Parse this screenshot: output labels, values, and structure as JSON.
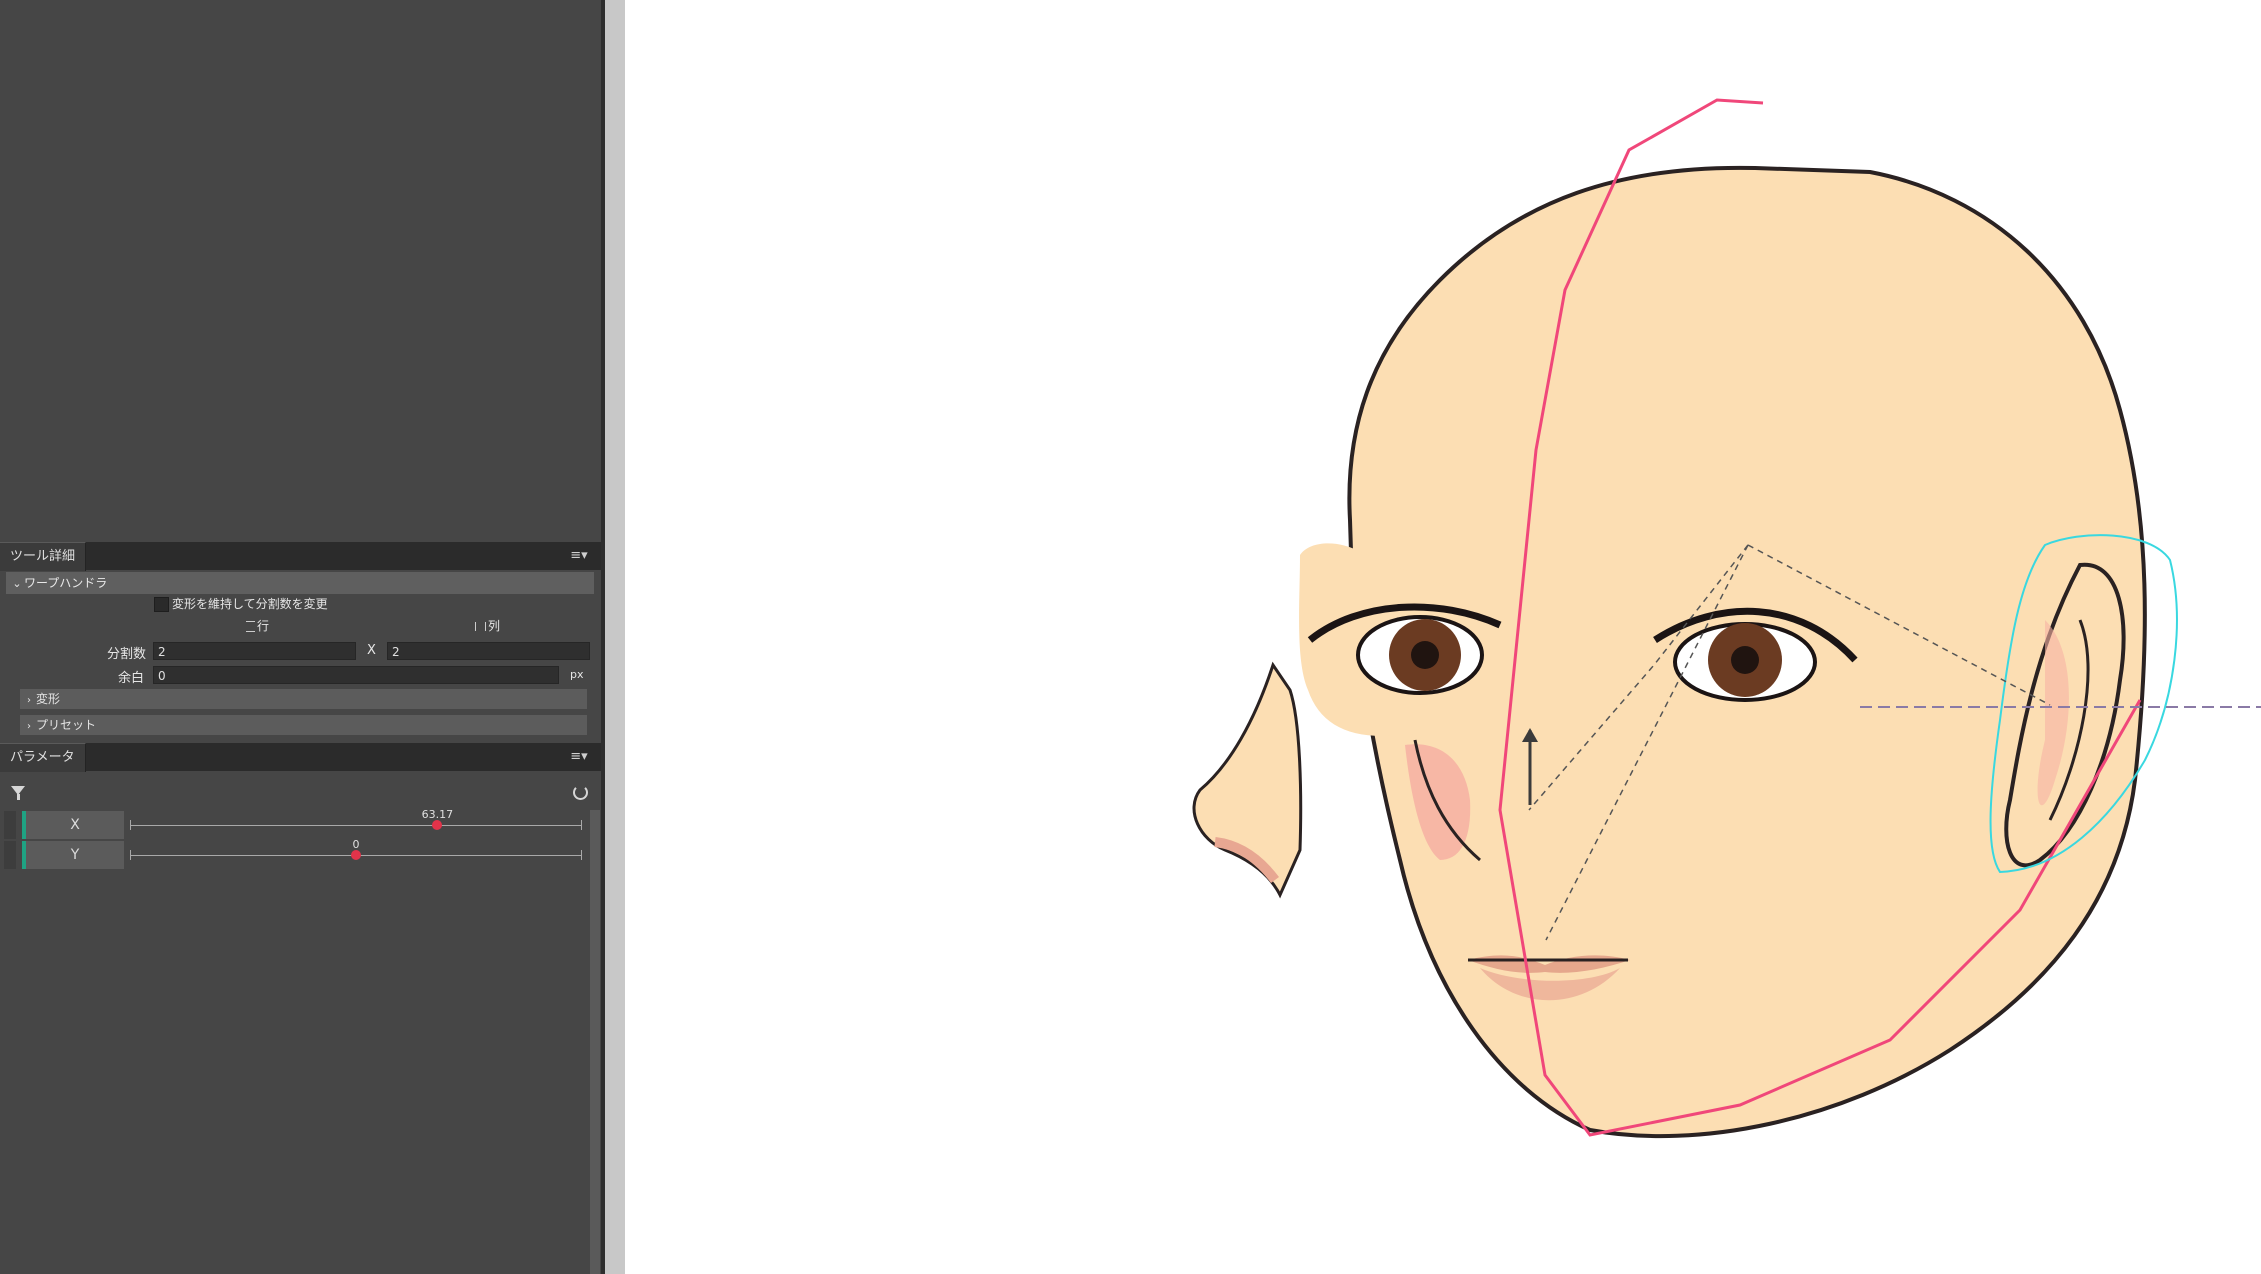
{
  "tool_detail": {
    "tab_label": "ツール詳細",
    "menu_icon": "panel-menu-icon",
    "section_label": "ワープハンドラ",
    "keep_deform_label": "変形を維持して分割数を変更",
    "row_label": "行",
    "col_label": "列",
    "divisions_label": "分割数",
    "divisions_rows": "2",
    "divisions_x": "X",
    "divisions_cols": "2",
    "margin_label": "余白",
    "margin_value": "0",
    "margin_unit": "px",
    "deform_label": "変形",
    "preset_label": "プリセット"
  },
  "parameters": {
    "tab_label": "パラメータ",
    "filter_icon": "filter-icon",
    "reset_icon": "reset-icon",
    "items": [
      {
        "name": "X",
        "value": "63.17",
        "fraction": 0.68
      },
      {
        "name": "Y",
        "value": "0",
        "fraction": 0.5
      }
    ]
  },
  "colors": {
    "skin": "#fcdeb3",
    "outline": "#2a2222",
    "deformer_pink": "#f0477a",
    "deformer_cyan": "#39d8e0",
    "accent_green": "#1fa383",
    "slider_knob": "#e2334a"
  }
}
